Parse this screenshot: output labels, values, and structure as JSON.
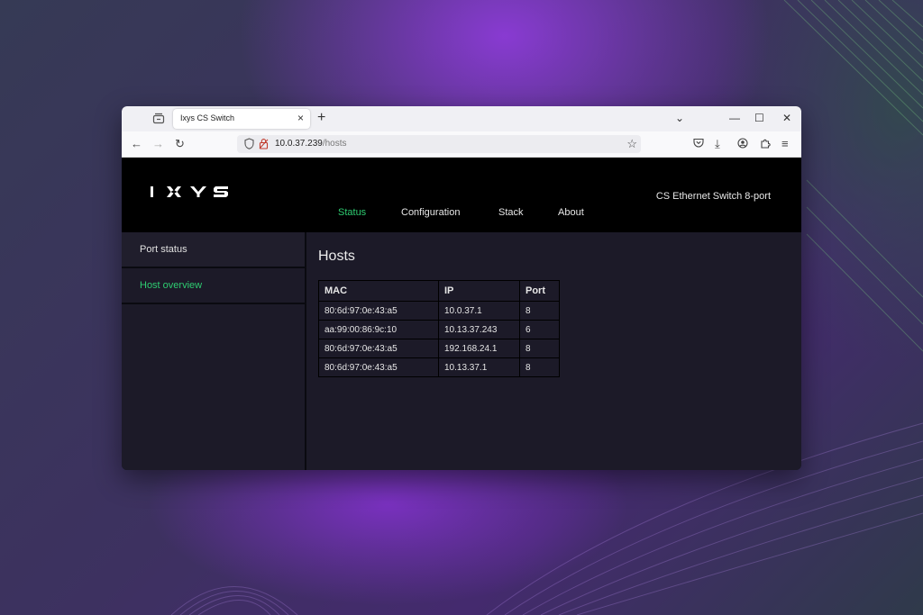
{
  "browser": {
    "tab_title": "Ixys CS Switch",
    "url_host": "10.0.37.239",
    "url_path": "/hosts"
  },
  "header": {
    "logo_text": "IXYS",
    "device_name": "CS Ethernet Switch 8-port",
    "nav": [
      {
        "label": "Status",
        "active": true
      },
      {
        "label": "Configuration",
        "active": false
      },
      {
        "label": "Stack",
        "active": false
      },
      {
        "label": "About",
        "active": false
      }
    ]
  },
  "sidebar": {
    "items": [
      {
        "label": "Port status",
        "active": false
      },
      {
        "label": "Host overview",
        "active": true
      }
    ]
  },
  "main": {
    "title": "Hosts",
    "table": {
      "headers": [
        "MAC",
        "IP",
        "Port"
      ],
      "rows": [
        [
          "80:6d:97:0e:43:a5",
          "10.0.37.1",
          "8"
        ],
        [
          "aa:99:00:86:9c:10",
          "10.13.37.243",
          "6"
        ],
        [
          "80:6d:97:0e:43:a5",
          "192.168.24.1",
          "8"
        ],
        [
          "80:6d:97:0e:43:a5",
          "10.13.37.1",
          "8"
        ]
      ]
    }
  },
  "colors": {
    "accent_green": "#2ecc71",
    "header_bg": "#000000",
    "page_bg": "#1c1a28"
  }
}
